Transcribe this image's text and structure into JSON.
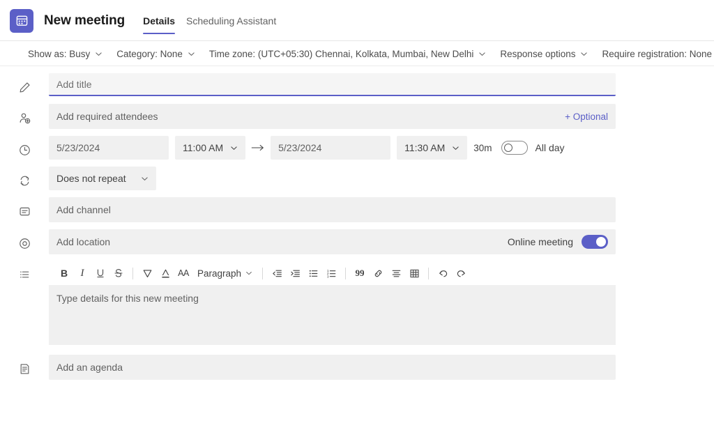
{
  "header": {
    "app_icon": "calendar-icon",
    "title": "New meeting",
    "tabs": [
      {
        "label": "Details",
        "active": true
      },
      {
        "label": "Scheduling Assistant",
        "active": false
      }
    ]
  },
  "options_bar": [
    {
      "label": "Show as: Busy",
      "icon": "chevron-down-icon"
    },
    {
      "label": "Category: None",
      "icon": "chevron-down-icon"
    },
    {
      "label": "Time zone: (UTC+05:30) Chennai, Kolkata, Mumbai, New Delhi",
      "icon": "chevron-down-icon"
    },
    {
      "label": "Response options",
      "icon": "chevron-down-icon"
    },
    {
      "label": "Require registration: None",
      "icon": "chevron-down-icon"
    }
  ],
  "form": {
    "title_row": {
      "icon": "pencil-icon",
      "placeholder": "Add title",
      "value": ""
    },
    "attendees_row": {
      "icon": "add-person-icon",
      "placeholder": "Add required attendees",
      "optional_label": "+ Optional"
    },
    "datetime_row": {
      "icon": "clock-icon",
      "start_date": "5/23/2024",
      "start_time": "11:00 AM",
      "arrow": "→",
      "end_date": "5/23/2024",
      "end_time": "11:30 AM",
      "duration": "30m",
      "all_day_label": "All day",
      "all_day_on": false
    },
    "repeat_row": {
      "icon": "repeat-icon",
      "value": "Does not repeat"
    },
    "channel_row": {
      "icon": "channel-icon",
      "placeholder": "Add channel"
    },
    "location_row": {
      "icon": "location-icon",
      "placeholder": "Add location",
      "online_meeting_label": "Online meeting",
      "online_meeting_on": true
    },
    "details_row": {
      "icon": "list-icon",
      "placeholder": "Type details for this new meeting",
      "toolbar": [
        {
          "name": "bold-icon",
          "label": "B"
        },
        {
          "name": "italic-icon",
          "label": "I"
        },
        {
          "name": "underline-icon",
          "label": "U"
        },
        {
          "name": "strikethrough-icon",
          "label": "S"
        },
        {
          "name": "highlight-icon",
          "label": ""
        },
        {
          "name": "font-color-icon",
          "label": ""
        },
        {
          "name": "font-size-icon",
          "label": "AA"
        },
        {
          "name": "paragraph-style-dropdown",
          "label": "Paragraph"
        },
        {
          "name": "decrease-indent-icon",
          "label": ""
        },
        {
          "name": "increase-indent-icon",
          "label": ""
        },
        {
          "name": "bulleted-list-icon",
          "label": ""
        },
        {
          "name": "numbered-list-icon",
          "label": ""
        },
        {
          "name": "quote-icon",
          "label": "99"
        },
        {
          "name": "link-icon",
          "label": ""
        },
        {
          "name": "align-icon",
          "label": ""
        },
        {
          "name": "table-icon",
          "label": ""
        },
        {
          "name": "undo-icon",
          "label": ""
        },
        {
          "name": "redo-icon",
          "label": ""
        }
      ]
    },
    "agenda_row": {
      "icon": "agenda-icon",
      "placeholder": "Add an agenda"
    }
  },
  "colors": {
    "accent": "#5b5fc7",
    "field_bg": "#f0f0f0",
    "text": "#242424",
    "muted_text": "#616161"
  }
}
